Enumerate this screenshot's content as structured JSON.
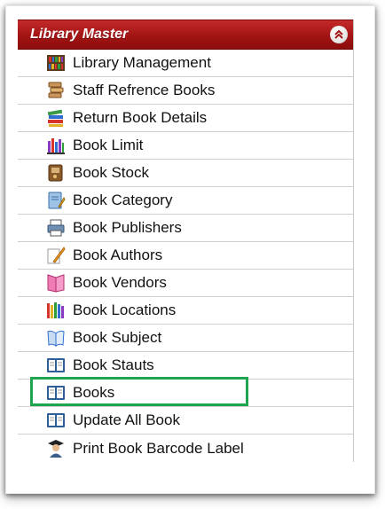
{
  "menu": {
    "title": "Library Master",
    "collapse_icon": "chevron-up-double-icon",
    "highlight_color": "#1fa44f",
    "header_color": "#a21414",
    "items": [
      {
        "label": "Library Management",
        "icon": "bookshelf-icon"
      },
      {
        "label": "Staff Refrence Books",
        "icon": "book-stack-icon"
      },
      {
        "label": "Return Book Details",
        "icon": "books-return-icon"
      },
      {
        "label": "Book Limit",
        "icon": "books-limit-icon"
      },
      {
        "label": "Book Stock",
        "icon": "book-stock-icon"
      },
      {
        "label": "Book Category",
        "icon": "notebook-pencil-icon"
      },
      {
        "label": "Book Publishers",
        "icon": "printer-icon"
      },
      {
        "label": "Book Authors",
        "icon": "quill-pen-icon"
      },
      {
        "label": "Book Vendors",
        "icon": "pink-book-icon"
      },
      {
        "label": "Book Locations",
        "icon": "book-shelf-colored-icon"
      },
      {
        "label": "Book Subject",
        "icon": "open-book-blue-icon"
      },
      {
        "label": "Book Stauts",
        "icon": "open-book-icon"
      },
      {
        "label": "Books",
        "icon": "open-book-icon",
        "highlighted": true
      },
      {
        "label": "Update All Book",
        "icon": "open-book-icon"
      },
      {
        "label": "Print Book Barcode Label",
        "icon": "graduate-icon"
      }
    ]
  }
}
